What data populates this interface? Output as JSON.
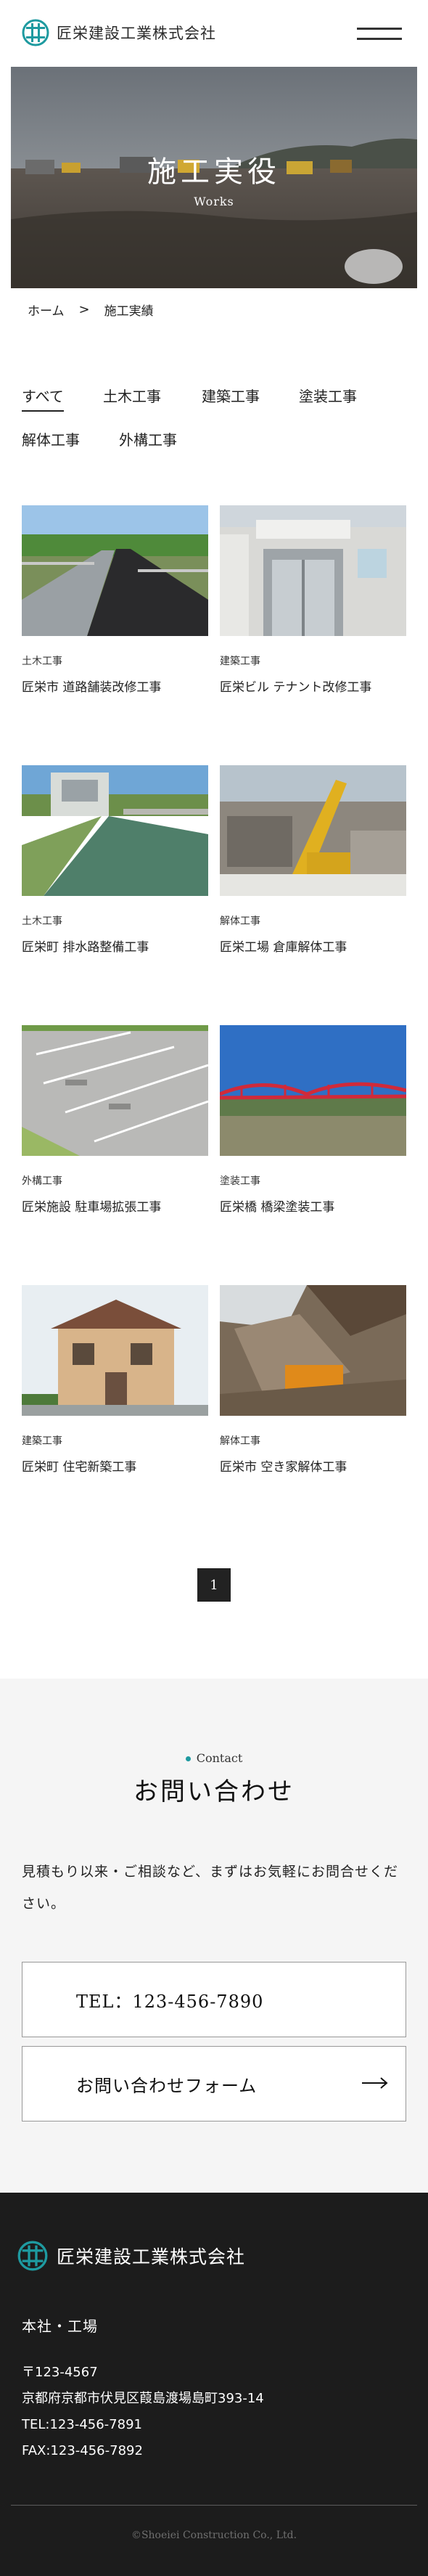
{
  "header": {
    "company_name": "匠栄建設工業株式会社",
    "menu_icon": "hamburger-menu-icon"
  },
  "hero": {
    "title": "施工実役",
    "subtitle": "Works"
  },
  "breadcrumb": {
    "home": "ホーム",
    "separator": ">",
    "current": "施工実績"
  },
  "tabs": [
    {
      "label": "すべて",
      "active": true
    },
    {
      "label": "土木工事",
      "active": false
    },
    {
      "label": "建築工事",
      "active": false
    },
    {
      "label": "塗装工事",
      "active": false
    },
    {
      "label": "解体工事",
      "active": false
    },
    {
      "label": "外構工事",
      "active": false
    }
  ],
  "works": [
    {
      "category": "土木工事",
      "title": "匠栄市 道路舗装改修工事"
    },
    {
      "category": "建築工事",
      "title": "匠栄ビル テナント改修工事"
    },
    {
      "category": "土木工事",
      "title": "匠栄町 排水路整備工事"
    },
    {
      "category": "解体工事",
      "title": "匠栄工場 倉庫解体工事"
    },
    {
      "category": "外構工事",
      "title": "匠栄施設 駐車場拡張工事"
    },
    {
      "category": "塗装工事",
      "title": "匠栄橋 橋梁塗装工事"
    },
    {
      "category": "建築工事",
      "title": "匠栄町 住宅新築工事"
    },
    {
      "category": "解体工事",
      "title": "匠栄市 空き家解体工事"
    }
  ],
  "pagination": {
    "current_page": "1"
  },
  "contact": {
    "label": "Contact",
    "title": "お問い合わせ",
    "text": "見積もり以来・ご相談など、まずはお気軽にお問合せください。",
    "tel_label": "TEL：123-456-7890",
    "form_label": "お問い合わせフォーム"
  },
  "footer": {
    "company_name": "匠栄建設工業株式会社",
    "section_title": "本社・工場",
    "postal": "〒123-4567",
    "address": "京都府京都市伏見区葭島渡場島町393-14",
    "tel": "TEL:123-456-7891",
    "fax": "FAX:123-456-7892",
    "copyright": "©Shoeiei Construction Co., Ltd."
  },
  "colors": {
    "accent": "#1e9aa0",
    "dark": "#1c1c1c",
    "contact_bg": "#f5f5f5"
  }
}
